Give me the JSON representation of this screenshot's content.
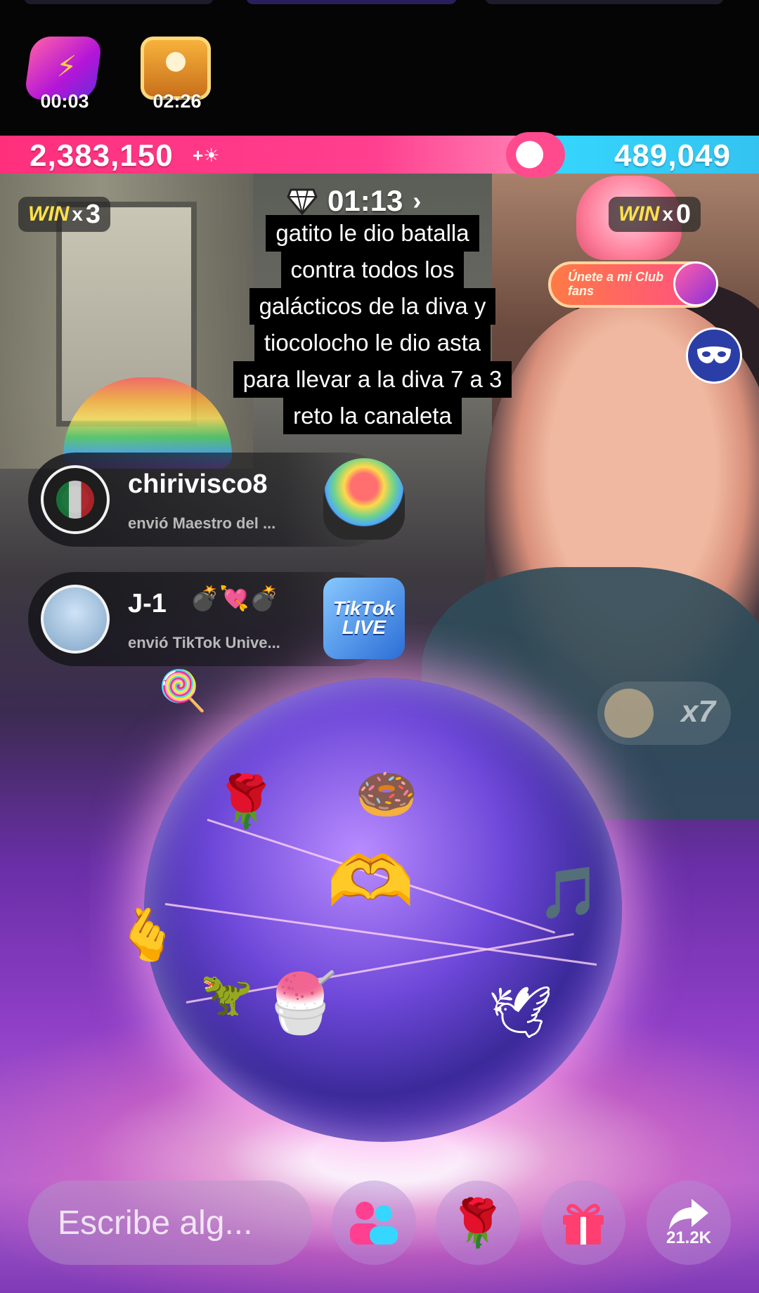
{
  "rewards": {
    "streak_timer": "00:03",
    "chest_timer": "02:26"
  },
  "battle": {
    "left_score": "2,383,150",
    "right_score": "489,049",
    "timer": "01:13",
    "left_win_label": "WIN",
    "left_win_x": "x",
    "left_win_count": "3",
    "right_win_label": "WIN",
    "right_win_x": "x",
    "right_win_count": "0"
  },
  "club": {
    "label": "Únete a mi Club fans"
  },
  "caption": {
    "lines": [
      "gatito le dio batalla",
      "contra todos los",
      "galácticos de la diva y",
      "tiocolocho le dio asta",
      "para llevar a la diva 7 a 3",
      "reto la canaleta"
    ]
  },
  "gifts": [
    {
      "user": "chirivisco8",
      "desc": "envió Maestro del ...",
      "emoji": ""
    },
    {
      "user": "J-1",
      "desc": "envió TikTok Unive...",
      "emoji": "💣💘💣"
    }
  ],
  "gift_image_text": "TikTok LIVE",
  "combo": {
    "count": "x7"
  },
  "bottom": {
    "comment_placeholder": "Escribe alg...",
    "share_count": "21.2K"
  },
  "colors": {
    "left_team": "#ff3f8f",
    "right_team": "#35d7ff",
    "win_gold": "#ffe14a"
  },
  "icons": {
    "streak": "lightning-icon",
    "chest": "treasure-chest-icon",
    "timer": "diamond-trophy-icon",
    "mask": "mask-icon",
    "people": "people-icon",
    "rose": "rose-icon",
    "gift": "gift-icon",
    "share": "share-arrow-icon"
  }
}
